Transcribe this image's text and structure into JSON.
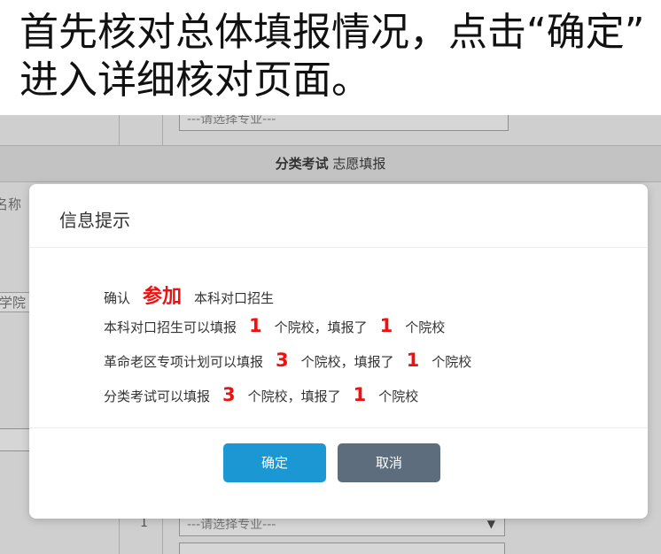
{
  "instruction": {
    "line1": "首先核对总体填报情况，点击“确定”",
    "line2": "进入详细核对页面。"
  },
  "background": {
    "top_select": "---请选择专业---",
    "section_header_bold": "分类考试",
    "section_header_rest": " 志愿填报",
    "label_name": "名称",
    "label_school": "学院",
    "bottom_select": "---请选择专业---",
    "bottom_num": "1"
  },
  "dialog": {
    "title": "信息提示",
    "confirm_prefix": "确认",
    "confirm_action": "参加",
    "confirm_target": "本科对口招生",
    "rows": [
      {
        "category": "本科对口招生可以填报",
        "allowed": "1",
        "mid": "个院校，填报了",
        "filled": "1",
        "suffix": "个院校"
      },
      {
        "category": "革命老区专项计划可以填报",
        "allowed": "3",
        "mid": "个院校，填报了",
        "filled": "1",
        "suffix": "个院校"
      },
      {
        "category": "分类考试可以填报",
        "allowed": "3",
        "mid": "个院校，填报了",
        "filled": "1",
        "suffix": "个院校"
      }
    ],
    "ok_label": "确定",
    "cancel_label": "取消"
  },
  "colors": {
    "highlight": "#ee1111",
    "ok_button": "#1b97d4",
    "cancel_button": "#5d6d7e",
    "overlay": "#cfcfcf"
  }
}
